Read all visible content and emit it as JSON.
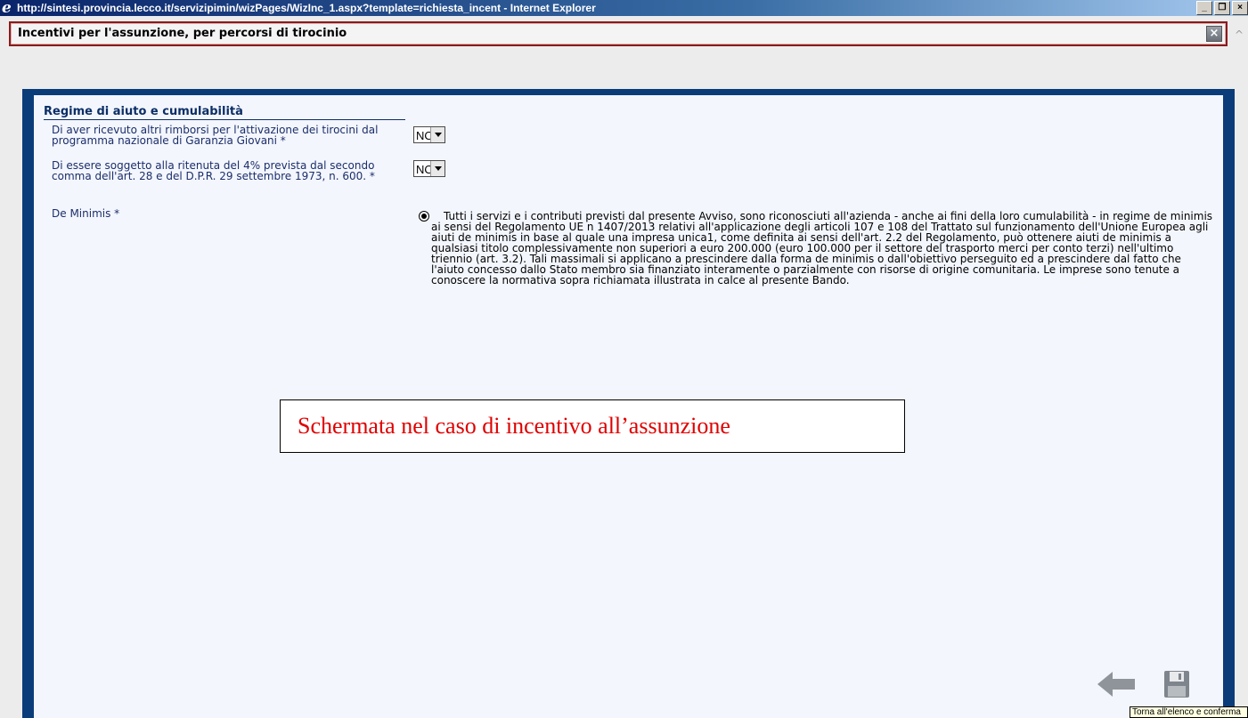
{
  "window": {
    "title": "http://sintesi.provincia.lecco.it/servizipimin/wizPages/WizInc_1.aspx?template=richiesta_incent - Internet Explorer",
    "ie_icon": "e",
    "minimize": "_",
    "maximize": "❐",
    "close": "×"
  },
  "dialog": {
    "title": "Incentivi per l'assunzione, per percorsi di tirocinio",
    "close": "×",
    "scroll_up": "^"
  },
  "form": {
    "section_title": "Regime di aiuto e cumulabilità",
    "field1_label": "Di aver ricevuto altri rimborsi per l'attivazione dei tirocini dal programma nazionale di Garanzia Giovani *",
    "field1_value": "NO",
    "field2_label": "Di essere soggetto alla ritenuta del 4% prevista dal secondo comma dell'art. 28 e del D.P.R. 29 settembre 1973, n. 600. *",
    "field2_value": "NO",
    "deminimis_label": "De Minimis *",
    "deminimis_text": "Tutti i servizi e i contributi previsti dal presente Avviso, sono riconosciuti all'azienda - anche ai fini della loro cumulabilità - in regime de minimis ai sensi del Regolamento UE n 1407/2013 relativi all'applicazione degli articoli 107 e 108 del Trattato sul funzionamento dell'Unione Europea agli aiuti de minimis in base al quale una impresa unica1, come definita ai sensi dell'art. 2.2 del Regolamento, può ottenere aiuti de minimis a qualsiasi titolo complessivamente non superiori a euro 200.000 (euro 100.000 per il settore del trasporto merci per conto terzi) nell'ultimo triennio (art. 3.2). Tali massimali si applicano a prescindere dalla forma de minimis o dall'obiettivo perseguito ed a prescindere dal fatto che l'aiuto concesso dallo Stato membro sia finanziato interamente o parzialmente con risorse di origine comunitaria. Le imprese sono tenute a conoscere la normativa sopra richiamata illustrata in calce al presente Bando."
  },
  "annotation": {
    "text": "Schermata nel caso di incentivo all’assunzione",
    "color": "#e00000"
  },
  "actions": {
    "back_icon": "arrow-left-icon",
    "save_icon": "floppy-disk-icon",
    "tooltip": "Torna all'elenco e conferma"
  }
}
